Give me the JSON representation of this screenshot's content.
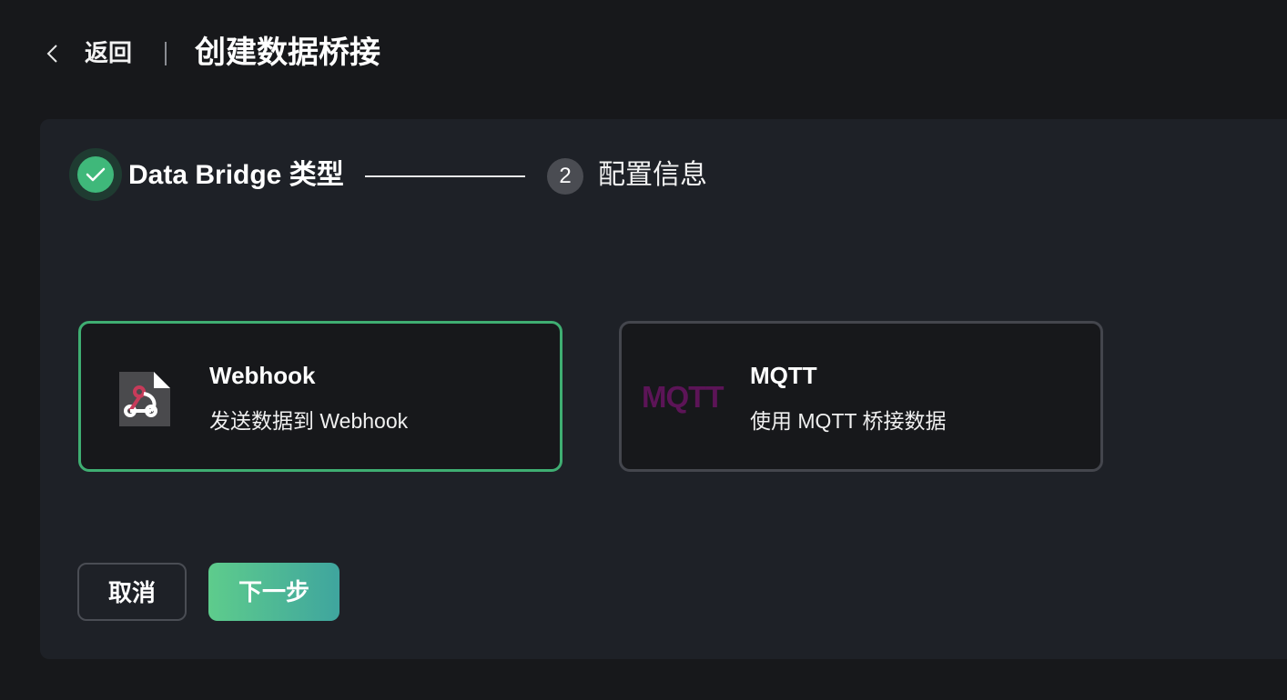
{
  "header": {
    "back_label": "返回",
    "title": "创建数据桥接"
  },
  "steps": [
    {
      "number": "1",
      "label": "Data Bridge 类型",
      "status": "completed"
    },
    {
      "number": "2",
      "label": "配置信息",
      "status": "pending"
    }
  ],
  "cards": {
    "webhook": {
      "title": "Webhook",
      "description": "发送数据到 Webhook",
      "selected": true
    },
    "mqtt": {
      "logo_text": "MQTT",
      "title": "MQTT",
      "description": "使用 MQTT 桥接数据",
      "selected": false
    }
  },
  "actions": {
    "cancel_label": "取消",
    "next_label": "下一步"
  },
  "colors": {
    "accent": "#3fae72",
    "background": "#17181b",
    "panel": "#1e2127",
    "mqtt_brand": "#5c1457"
  }
}
